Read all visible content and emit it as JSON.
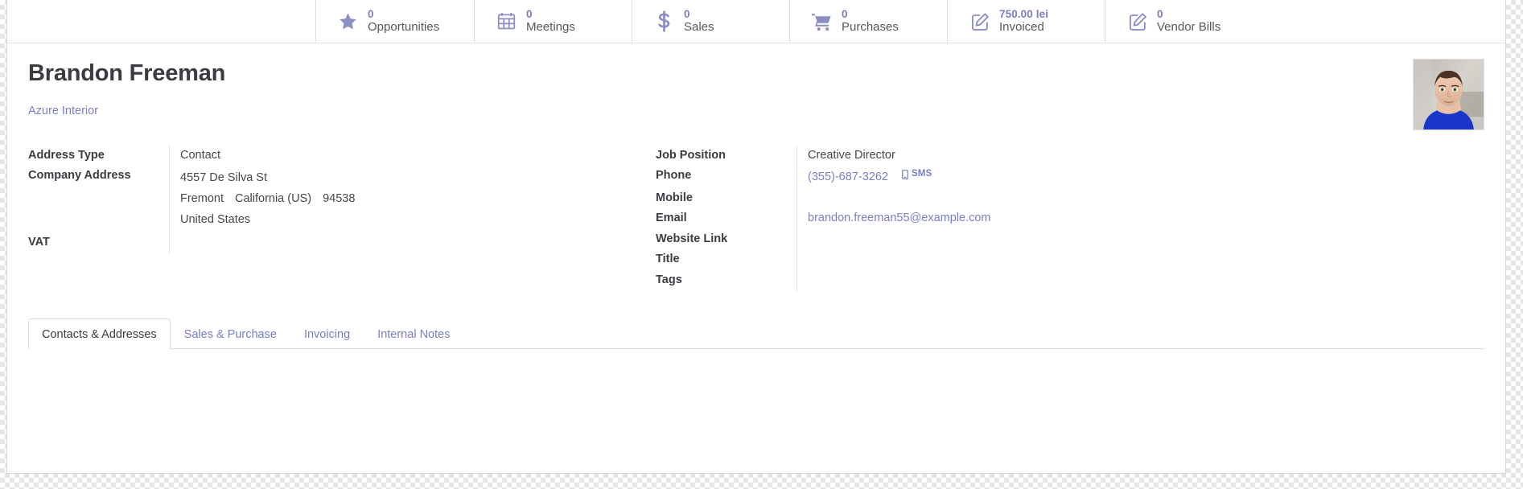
{
  "stat_buttons": [
    {
      "icon": "star-icon",
      "value": "0",
      "label": "Opportunities"
    },
    {
      "icon": "calendar-icon",
      "value": "0",
      "label": "Meetings"
    },
    {
      "icon": "dollar-icon",
      "value": "0",
      "label": "Sales"
    },
    {
      "icon": "cart-icon",
      "value": "0",
      "label": "Purchases"
    },
    {
      "icon": "pencil-square-icon",
      "value": "750.00 lei",
      "label": "Invoiced"
    },
    {
      "icon": "pencil-square-icon",
      "value": "0",
      "label": "Vendor Bills"
    }
  ],
  "record": {
    "title": "Brandon Freeman",
    "parent_company": "Azure Interior",
    "avatar_alt": "contact-photo"
  },
  "left_fields": {
    "address_type_label": "Address Type",
    "address_type_value": "Contact",
    "company_address_label": "Company Address",
    "address": {
      "street": "4557 De Silva St",
      "city": "Fremont",
      "state": "California (US)",
      "zip": "94538",
      "country": "United States"
    },
    "vat_label": "VAT",
    "vat_value": ""
  },
  "right_fields": {
    "job_position_label": "Job Position",
    "job_position_value": "Creative Director",
    "phone_label": "Phone",
    "phone_value": "(355)-687-3262",
    "sms_label": "SMS",
    "mobile_label": "Mobile",
    "mobile_value": "",
    "email_label": "Email",
    "email_value": "brandon.freeman55@example.com",
    "website_label": "Website Link",
    "website_value": "",
    "title_label": "Title",
    "title_value": "",
    "tags_label": "Tags",
    "tags_value": ""
  },
  "tabs": [
    {
      "label": "Contacts & Addresses",
      "active": true
    },
    {
      "label": "Sales & Purchase",
      "active": false
    },
    {
      "label": "Invoicing",
      "active": false
    },
    {
      "label": "Internal Notes",
      "active": false
    }
  ],
  "colors": {
    "accent": "#7a7fc2",
    "icon": "#8a8ec4",
    "text": "#3b3b42",
    "border": "#dededf"
  }
}
